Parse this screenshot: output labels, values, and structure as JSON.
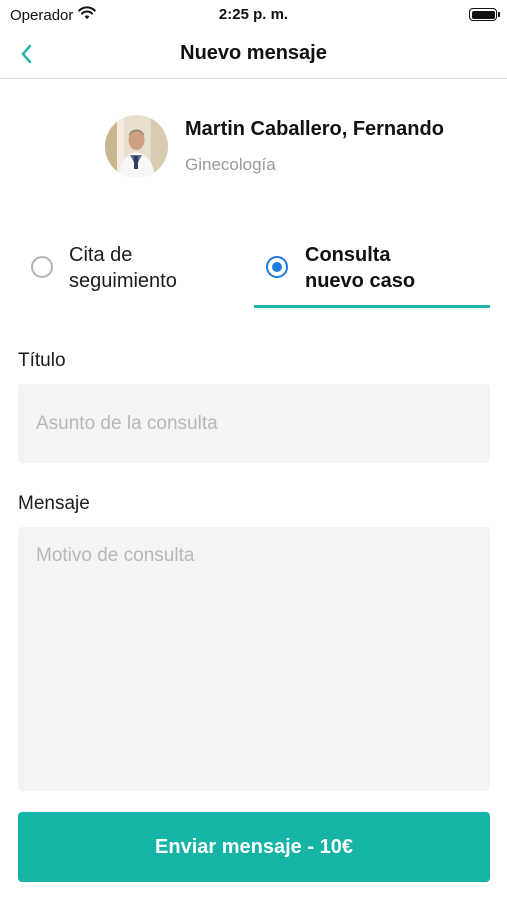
{
  "status_bar": {
    "carrier": "Operador",
    "time": "2:25 p. m.",
    "wifi_icon": "wifi-icon",
    "battery_icon": "battery-full-icon"
  },
  "nav": {
    "title": "Nuevo mensaje",
    "back_icon": "chevron-left-icon"
  },
  "doctor": {
    "name": "Martin Caballero, Fernando",
    "specialty": "Ginecología",
    "avatar_icon": "doctor-photo"
  },
  "consultation_type": {
    "options": [
      {
        "label_line1": "Cita de",
        "label_line2": "seguimiento",
        "selected": false
      },
      {
        "label_line1": "Consulta",
        "label_line2": "nuevo caso",
        "selected": true
      }
    ]
  },
  "form": {
    "title_label": "Título",
    "title_placeholder": "Asunto de la consulta",
    "title_value": "",
    "message_label": "Mensaje",
    "message_placeholder": "Motivo de consulta",
    "message_value": ""
  },
  "send_button": {
    "label": "Enviar mensaje - 10€"
  },
  "colors": {
    "accent": "#16b3a7",
    "accent_line": "#26b5aa",
    "radio_selected": "#1f7be0",
    "input_bg": "#f4f4f4",
    "placeholder": "#b8b8b8"
  }
}
